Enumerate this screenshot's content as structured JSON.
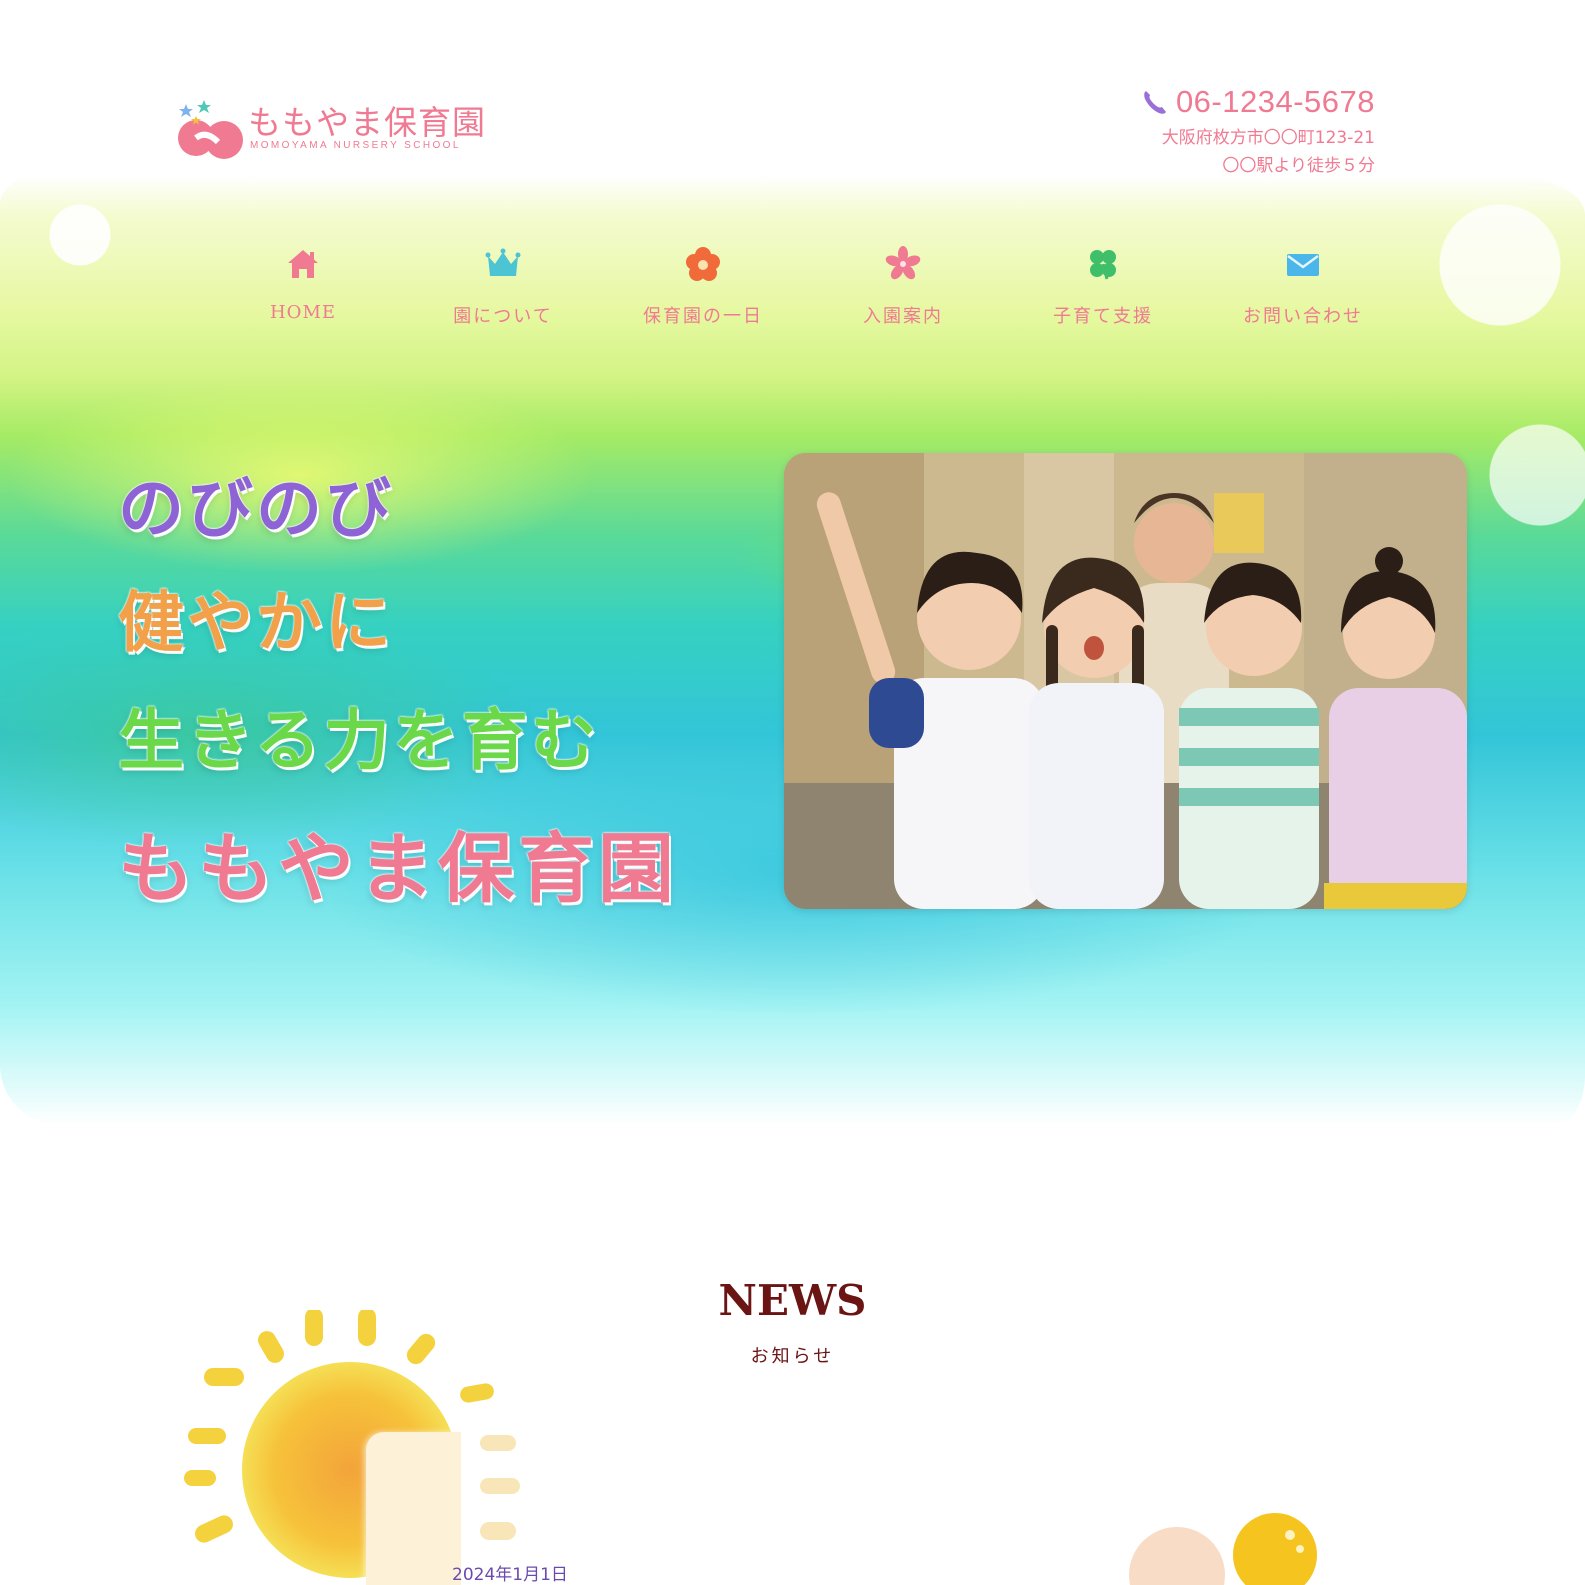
{
  "header": {
    "logo_title": "ももやま保育園",
    "logo_subtitle": "MOMOYAMA NURSERY SCHOOL",
    "phone": "06-1234-5678",
    "address_line1": "大阪府枚方市〇〇町123-21",
    "address_line2": "〇〇駅より徒歩５分"
  },
  "nav": {
    "items": [
      {
        "label": "HOME",
        "icon": "house-icon",
        "color": "#f07a92"
      },
      {
        "label": "園について",
        "icon": "crown-icon",
        "color": "#4cc4d4"
      },
      {
        "label": "保育園の一日",
        "icon": "flower-icon",
        "color": "#f06a3a"
      },
      {
        "label": "入園案内",
        "icon": "sakura-icon",
        "color": "#f07a92"
      },
      {
        "label": "子育て支援",
        "icon": "clover-icon",
        "color": "#3fbf6a"
      },
      {
        "label": "お問い合わせ",
        "icon": "mail-icon",
        "color": "#4ab6ea"
      }
    ]
  },
  "hero": {
    "line1": "のびのび",
    "line2": "健やかに",
    "line3": "生きる力を育む",
    "line4": "ももやま保育園",
    "photo_alt": "children-group-photo"
  },
  "news": {
    "title": "NEWS",
    "subtitle": "お知らせ",
    "first_date": "2024年1月1日"
  },
  "colors": {
    "brand_pink": "#f07a92",
    "purple": "#8d63d6",
    "orange": "#f2a04a",
    "green": "#6ad848",
    "news_text": "#6b1414"
  }
}
